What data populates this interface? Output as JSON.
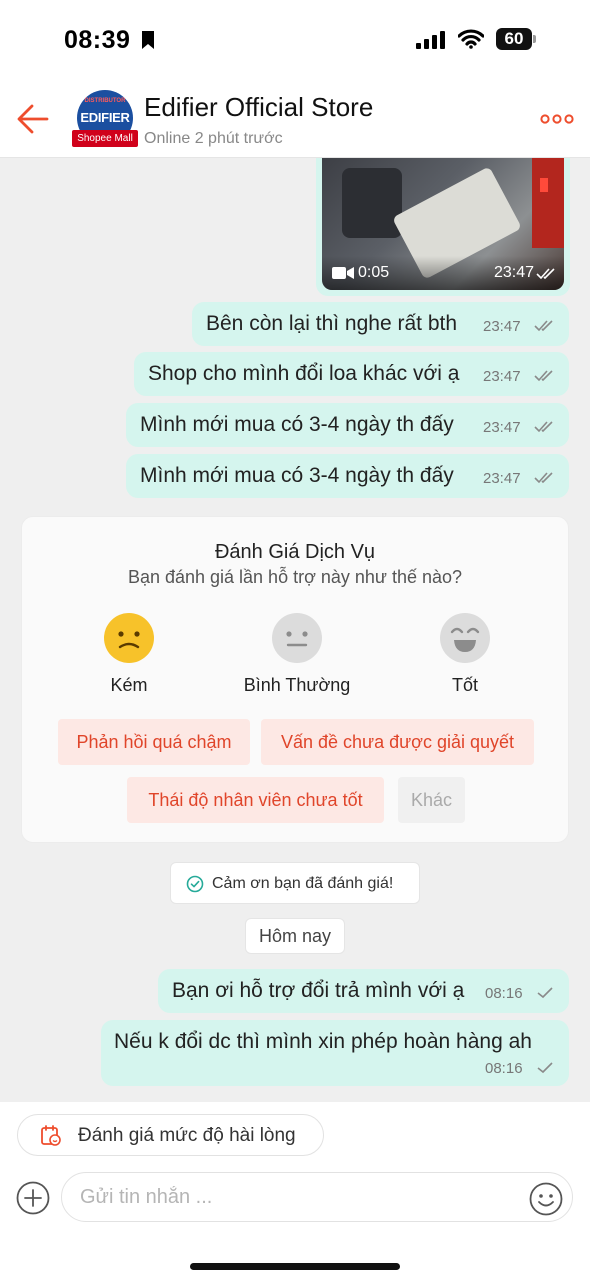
{
  "status_bar": {
    "time": "08:39",
    "battery": "60"
  },
  "header": {
    "store_name": "Edifier Official Store",
    "status": "Online 2 phút trước",
    "avatar_brand": "EDIFIER",
    "avatar_brand_top": "DISTRIBUTOR",
    "mall_badge": "Shopee Mall"
  },
  "video_message": {
    "duration": "0:05",
    "time": "23:47"
  },
  "messages": [
    {
      "text": "Bên còn lại thì nghe rất bth",
      "time": "23:47"
    },
    {
      "text": "Shop cho mình đổi loa khác với ạ",
      "time": "23:47"
    },
    {
      "text": "Mình mới mua có 3-4 ngày th đấy",
      "time": "23:47"
    },
    {
      "text": "Mình mới mua có 3-4 ngày th đấy",
      "time": "23:47"
    }
  ],
  "rating": {
    "title": "Đánh Giá Dịch Vụ",
    "subtitle": "Bạn đánh giá lần hỗ trợ này như thế nào?",
    "options": [
      {
        "label": "Kém",
        "icon": "sad-face-icon",
        "color": "#f7c22a"
      },
      {
        "label": "Bình Thường",
        "icon": "neutral-face-icon",
        "color": "#dcdcdc"
      },
      {
        "label": "Tốt",
        "icon": "happy-face-icon",
        "color": "#dcdcdc"
      }
    ],
    "tags": [
      "Phản hồi quá chậm",
      "Vấn đề chưa được giải quyết",
      "Thái độ nhân viên chưa tốt",
      "Khác"
    ]
  },
  "thanks_text": "Cảm ơn bạn đã đánh giá!",
  "date_divider": "Hôm nay",
  "today_messages": [
    {
      "text": "Bạn ơi hỗ trợ đổi trả mình với ạ",
      "time": "08:16"
    },
    {
      "text": "Nếu k đổi dc thì mình xin phép hoàn hàng ah",
      "time": "08:16"
    }
  ],
  "bottom": {
    "satisfaction_label": "Đánh giá mức độ hài lòng",
    "input_placeholder": "Gửi tin nhắn ..."
  },
  "colors": {
    "accent": "#ee4d2d",
    "bubble": "#d5f5ee",
    "tag_bg": "#fde8e4",
    "tag_text": "#e0452a"
  }
}
